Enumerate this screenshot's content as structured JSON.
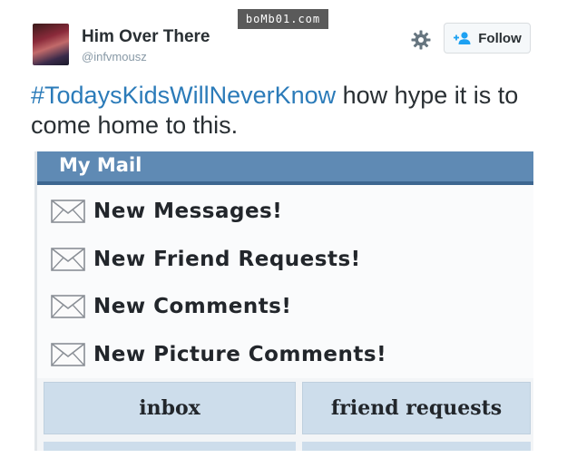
{
  "watermark": "boMb01.com",
  "tweet": {
    "user_name": "Him Over There",
    "user_handle": "@infvmousz",
    "follow_label": "Follow",
    "hashtag": "#TodaysKidsWillNeverKnow",
    "text": " how hype it is to come home to this."
  },
  "mail": {
    "title": "My Mail",
    "items": [
      {
        "label": "New Messages!"
      },
      {
        "label": "New Friend Requests!"
      },
      {
        "label": "New Comments!"
      },
      {
        "label": "New Picture Comments!"
      }
    ],
    "tabs": [
      {
        "label": "inbox"
      },
      {
        "label": "friend requests"
      }
    ]
  },
  "colors": {
    "hashtag": "#2b7bb9",
    "mail_header": "#5f8ab4",
    "mail_tab": "#cdddeb"
  },
  "icons": {
    "settings": "gear-icon",
    "follow": "add-person-icon",
    "mail_item": "envelope-icon"
  }
}
